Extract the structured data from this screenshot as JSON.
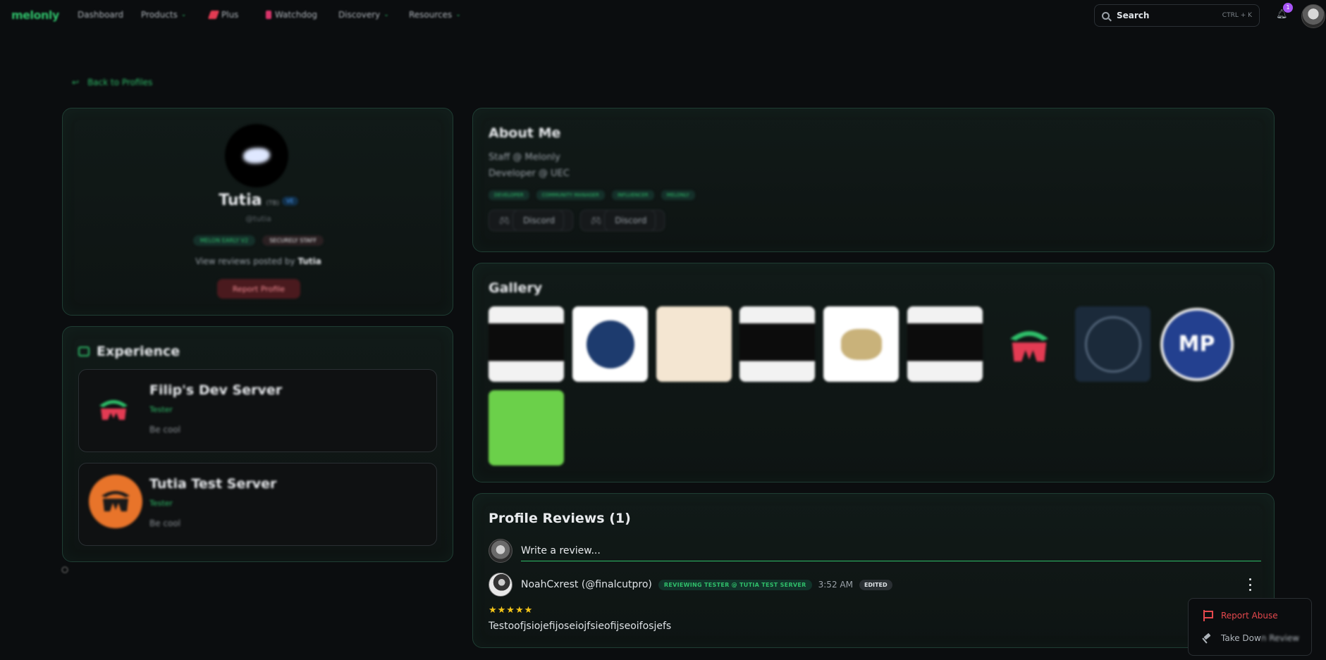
{
  "nav": {
    "logo": "melonly",
    "items": [
      {
        "label": "Dashboard"
      },
      {
        "label": "Products"
      },
      {
        "label": "Plus"
      },
      {
        "label": "Watchdog"
      },
      {
        "label": "Discovery"
      },
      {
        "label": "Resources"
      }
    ],
    "search": {
      "label": "Search",
      "shortcut": "CTRL + K"
    },
    "notification_count": "1"
  },
  "back_link": "Back to Profiles",
  "profile": {
    "name": "Tutia",
    "tag": "(TB)",
    "verified": "VE",
    "handle": "@tutia",
    "badges": [
      "MELON EARLY V2",
      "SECURELY STAFF"
    ],
    "view_text": "View reviews posted by",
    "view_name": "Tutia",
    "report_label": "Report Profile"
  },
  "experience": {
    "title": "Experience",
    "items": [
      {
        "name": "Filip's Dev Server",
        "role": "Tester",
        "desc": "Be cool"
      },
      {
        "name": "Tutia Test Server",
        "role": "Tester",
        "desc": "Be cool"
      }
    ]
  },
  "about": {
    "title": "About Me",
    "lines": [
      "Staff @ Melonly",
      "Developer @ UEC"
    ],
    "tags": [
      "DEVELOPER",
      "COMMUNITY MANAGER",
      "INFLUENCER",
      "MELONLY"
    ],
    "socials": [
      "Discord",
      "Discord"
    ]
  },
  "gallery": {
    "title": "Gallery",
    "mp_text": "MP"
  },
  "reviews": {
    "title": "Profile Reviews (1)",
    "write_placeholder": "Write a review...",
    "items": [
      {
        "author": "NoahCxrest (@finalcutpro)",
        "badge": "REVIEWING TESTER @ TUTIA TEST SERVER",
        "time": "3:52 AM",
        "edited": "EDITED",
        "stars": "★★★★★",
        "text": "Testoofjsiojefijoseiojfsieofijseoifosjefs"
      }
    ]
  },
  "menu": {
    "report_abuse": "Report Abuse",
    "take_down_prefix": "Take Dow",
    "take_down_rest": "n Review"
  },
  "colors": {
    "accent": "#2fbf6a",
    "danger": "#e5484d",
    "star": "#f5c518",
    "background": "#0b0d0f"
  }
}
